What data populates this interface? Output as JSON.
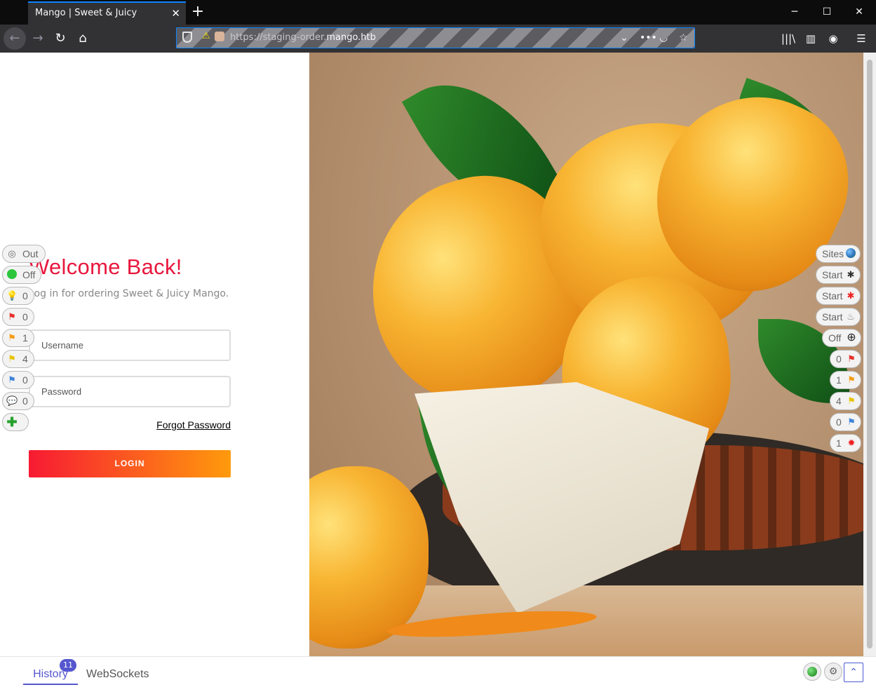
{
  "browser": {
    "tab_title": "Mango | Sweet & Juicy",
    "url_prefix": "https://staging-order.",
    "url_domain": "mango.htb",
    "accent_color": "#0a84ff"
  },
  "login": {
    "heading": "Welcome Back!",
    "subtitle": "Log in for ordering Sweet & Juicy Mango.",
    "username_placeholder": "Username",
    "password_placeholder": "Password",
    "forgot_label": "Forgot Password",
    "login_label": "LOGIN",
    "heading_color": "#e8173d"
  },
  "hud_left": [
    {
      "icon": "target-icon",
      "label": "Out"
    },
    {
      "icon": "green-dot-icon",
      "label": "Off"
    },
    {
      "icon": "lightbulb-icon",
      "label": "0"
    },
    {
      "icon": "red-flag-icon",
      "label": "0"
    },
    {
      "icon": "orange-flag-icon",
      "label": "1"
    },
    {
      "icon": "yellow-flag-icon",
      "label": "4"
    },
    {
      "icon": "blue-flag-icon",
      "label": "0"
    },
    {
      "icon": "comment-icon",
      "label": "0"
    },
    {
      "icon": "plus-icon",
      "label": ""
    }
  ],
  "hud_right": [
    {
      "icon": "globe-icon",
      "label": "Sites"
    },
    {
      "icon": "spider-icon",
      "label": "Start"
    },
    {
      "icon": "red-spider-icon",
      "label": "Start"
    },
    {
      "icon": "flame-icon",
      "label": "Start"
    },
    {
      "icon": "crosshair-icon",
      "label": "Off"
    },
    {
      "icon": "red-flag-icon",
      "label": "0"
    },
    {
      "icon": "orange-flag-icon",
      "label": "1"
    },
    {
      "icon": "yellow-flag-icon",
      "label": "4"
    },
    {
      "icon": "blue-flag-icon",
      "label": "0"
    },
    {
      "icon": "bug-icon",
      "label": "1"
    }
  ],
  "drawer": {
    "history_label": "History",
    "history_count": "11",
    "websockets_label": "WebSockets"
  }
}
